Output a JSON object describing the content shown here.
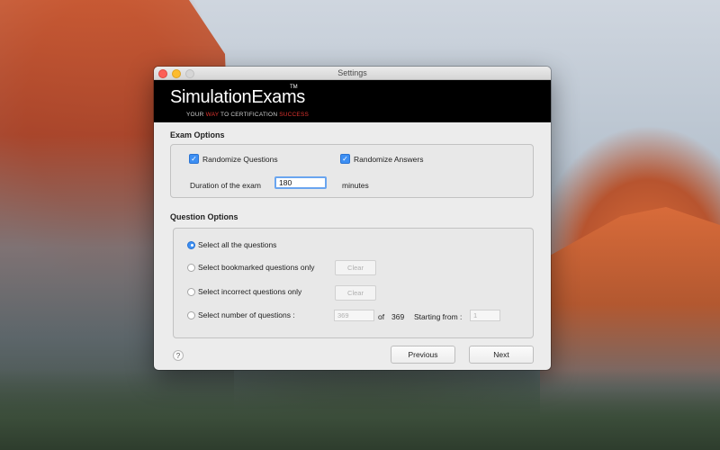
{
  "window": {
    "title": "Settings"
  },
  "banner": {
    "brand": "SimulationExams",
    "trademark": "TM",
    "tagline_parts": [
      "YOUR ",
      "WAY",
      " TO CERTIFICATION ",
      "SUCCESS"
    ]
  },
  "exam_options": {
    "title": "Exam Options",
    "randomize_questions": {
      "label": "Randomize Questions",
      "checked": true
    },
    "randomize_answers": {
      "label": "Randomize Answers",
      "checked": true
    },
    "duration_label": "Duration of the exam",
    "duration_value": "180",
    "duration_unit": "minutes"
  },
  "question_options": {
    "title": "Question Options",
    "options": [
      {
        "label": "Select all the questions",
        "selected": true
      },
      {
        "label": "Select bookmarked questions only",
        "selected": false
      },
      {
        "label": "Select incorrect questions only",
        "selected": false
      },
      {
        "label": "Select number of questions :",
        "selected": false
      }
    ],
    "clear_label": "Clear",
    "number_placeholder": "369",
    "of_label": "of",
    "total": "369",
    "starting_from_label": "Starting from :",
    "starting_from_placeholder": "1"
  },
  "footer": {
    "help": "?",
    "previous": "Previous",
    "next": "Next"
  },
  "colors": {
    "accent": "#3d8ff3",
    "brand_red": "#e0342f"
  }
}
